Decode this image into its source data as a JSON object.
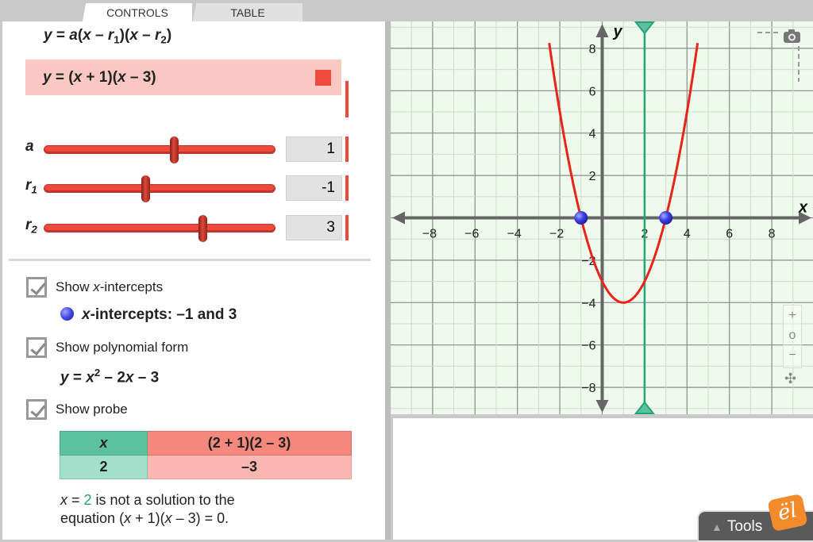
{
  "tabs": [
    {
      "label": "CONTROLS",
      "active": true
    },
    {
      "label": "TABLE",
      "active": false
    }
  ],
  "general_form": {
    "y": "y",
    "eq": " = ",
    "a": "a",
    "p1": "(",
    "x1": "x",
    "m1": " – ",
    "r1": "r",
    "s1": "1",
    "p2": ")(",
    "x2": "x",
    "m2": " – ",
    "r2": "r",
    "s2": "2",
    "p3": ")"
  },
  "equation": {
    "y": "y",
    "eq": " = (",
    "x1": "x",
    "t1": " + 1)(",
    "x2": "x",
    "t2": " – 3)",
    "color": "#f04a3c"
  },
  "sliders": [
    {
      "name": "a",
      "sub": "",
      "value": "1",
      "fraction": 0.5625
    },
    {
      "name": "r",
      "sub": "1",
      "value": "-1",
      "fraction": 0.4375
    },
    {
      "name": "r",
      "sub": "2",
      "value": "3",
      "fraction": 0.6875
    }
  ],
  "checkboxes": [
    {
      "pre": "Show ",
      "ital": "x",
      "post": "-intercepts",
      "checked": true
    },
    {
      "pre": "Show polynomial form",
      "ital": "",
      "post": "",
      "checked": true
    },
    {
      "pre": "Show probe",
      "ital": "",
      "post": "",
      "checked": true
    }
  ],
  "intercepts": {
    "ital": "x",
    "text": "-intercepts: –1 and 3"
  },
  "polynomial": {
    "y": "y",
    "eq": " = ",
    "x": "x",
    "exp": "2",
    "rest1": " – 2",
    "x2": "x",
    "rest2": " – 3"
  },
  "probe_table": {
    "header_x": "x",
    "header_expr": "(2 + 1)(2 – 3)",
    "value_x": "2",
    "value_expr": "–3"
  },
  "probe_text": {
    "x": "x",
    "eq": " = ",
    "val": "2",
    "line1_rest": " is not a solution to the",
    "line2_pre": "equation (",
    "x2": "x",
    "line2_mid": " + 1)(",
    "x3": "x",
    "line2_post": " – 3) = 0."
  },
  "graph": {
    "x_axis_label": "x",
    "y_axis_label": "y",
    "x_ticks": [
      "−8",
      "−6",
      "−4",
      "−2",
      "2",
      "4",
      "6",
      "8"
    ],
    "y_ticks": [
      "8",
      "6",
      "4",
      "2",
      "−2",
      "−4",
      "−6",
      "−8"
    ],
    "x_tick_values": [
      -8,
      -6,
      -4,
      -2,
      2,
      4,
      6,
      8
    ],
    "y_tick_values": [
      8,
      6,
      4,
      2,
      -2,
      -4,
      -6,
      -8
    ],
    "x_range": [
      -9.8,
      10
    ],
    "y_range": [
      -9.3,
      9.2
    ],
    "curve": {
      "a": 1,
      "r1": -1,
      "r2": 3,
      "color": "#e8241b"
    },
    "intercept_points": [
      -1,
      3
    ],
    "probe_x": 2,
    "probe_color": "#23a476",
    "zoom_controls": [
      "+",
      "o",
      "−"
    ]
  },
  "tools": {
    "label": "Tools",
    "logo": "ël"
  },
  "colors": {
    "accent_red": "#f04a3c",
    "probe_green": "#23a476",
    "graph_bg": "#eefbec"
  }
}
